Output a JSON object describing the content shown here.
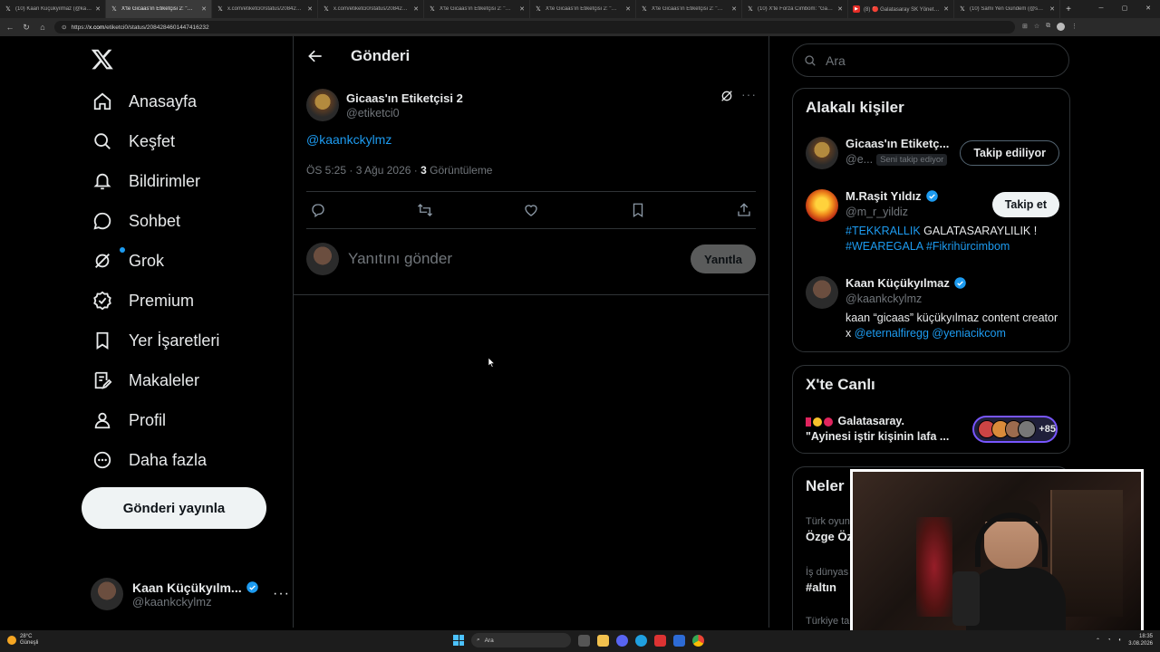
{
  "browser": {
    "tabs": [
      {
        "title": "(10) Kaan Küçükyılmaz (@kaank...",
        "icon": "x",
        "active": false
      },
      {
        "title": "X'te Gicaas'ın Etiketçisi 2: \"@m_r...",
        "icon": "x",
        "active": true
      },
      {
        "title": "x.com/etiketci0/status/208428460...",
        "icon": "x",
        "active": false
      },
      {
        "title": "x.com/etiketci0/status/208428460...",
        "icon": "x",
        "active": false
      },
      {
        "title": "X'te Gicaas'ın Etiketçisi 2: \"@Podi...",
        "icon": "x",
        "active": false
      },
      {
        "title": "X'te Gicaas'ın Etiketçisi 2: \"@fora...",
        "icon": "x",
        "active": false
      },
      {
        "title": "X'te Gicaas'ın Etiketçisi 2: \"@neyi...",
        "icon": "x",
        "active": false
      },
      {
        "title": "(10) X'te Forza Cimbom: \"Galata...",
        "icon": "x",
        "active": false
      },
      {
        "title": "(8) 🔴 Galatasaray SK Yönetim K...",
        "icon": "youtube",
        "active": false
      },
      {
        "title": "(10) Sami Yen Gündem (@samiye...",
        "icon": "x",
        "active": false
      }
    ],
    "url_prefix": "https://",
    "url_host": "x.com",
    "url_path": "/etiketci0/status/2084284601447416232"
  },
  "sidebar": {
    "items": [
      {
        "label": "Anasayfa",
        "icon": "home-icon"
      },
      {
        "label": "Keşfet",
        "icon": "search-icon"
      },
      {
        "label": "Bildirimler",
        "icon": "bell-icon"
      },
      {
        "label": "Sohbet",
        "icon": "chat-icon"
      },
      {
        "label": "Grok",
        "icon": "grok-icon"
      },
      {
        "label": "Premium",
        "icon": "premium-icon"
      },
      {
        "label": "Yer İşaretleri",
        "icon": "bookmark-icon"
      },
      {
        "label": "Makaleler",
        "icon": "articles-icon"
      },
      {
        "label": "Profil",
        "icon": "profile-icon"
      },
      {
        "label": "Daha fazla",
        "icon": "more-icon"
      }
    ],
    "post_button": "Gönderi yayınla",
    "account": {
      "name": "Kaan Küçükyılm...",
      "handle": "@kaankckylmz"
    }
  },
  "main": {
    "title": "Gönderi",
    "post": {
      "author_name": "Gicaas'ın Etiketçisi 2",
      "author_handle": "@etiketci0",
      "text": "@kaankckylmz",
      "time": "ÖS 5:25 · 3 Ağu 2026 · ",
      "views_count": "3",
      "views_label": " Görüntüleme"
    },
    "reply": {
      "placeholder": "Yanıtını gönder",
      "button": "Yanıtla"
    }
  },
  "right": {
    "search_placeholder": "Ara",
    "related": {
      "title": "Alakalı kişiler",
      "people": [
        {
          "name": "Gicaas'ın Etiketç...",
          "handle": "@e...",
          "badge": "Seni takip ediyor",
          "button": "Takip ediliyor",
          "verified": false,
          "bio": ""
        },
        {
          "name": "M.Raşit Yıldız",
          "handle": "@m_r_yildiz",
          "button": "Takip et",
          "verified": true,
          "bio_parts": [
            "#TEKKRALLIK",
            " GALATASARAYLILIK !",
            "#WEAREGALA",
            " ",
            "#Fikrihürcimbom"
          ]
        },
        {
          "name": "Kaan Küçükyılmaz",
          "handle": "@kaankckylmz",
          "button": "",
          "verified": true,
          "bio_parts": [
            "kaan “gicaas” küçükyılmaz content creator x ",
            "@eternalfiregg",
            " ",
            "@yeniacikcom"
          ]
        }
      ]
    },
    "live": {
      "title": "X'te Canlı",
      "line1": "Galatasaray.",
      "line2": "\"Ayinesi iştir kişinin lafa ...",
      "count": "+85"
    },
    "whats_happening": {
      "title": "Neler",
      "trends": [
        {
          "category": "Türk oyun",
          "name": "Özge Öz"
        },
        {
          "category": "İş dünyas",
          "name": "#altın"
        },
        {
          "category": "Türkiye ta",
          "name": ""
        }
      ]
    }
  },
  "taskbar": {
    "temp": "28°C",
    "weather": "Güneşli",
    "search": "Ara",
    "time": "18:35",
    "date": "3.08.2026"
  },
  "colors": {
    "accent": "#1d9bf0",
    "border": "#2f3336",
    "muted": "#71767b",
    "live": "#7856ff"
  }
}
